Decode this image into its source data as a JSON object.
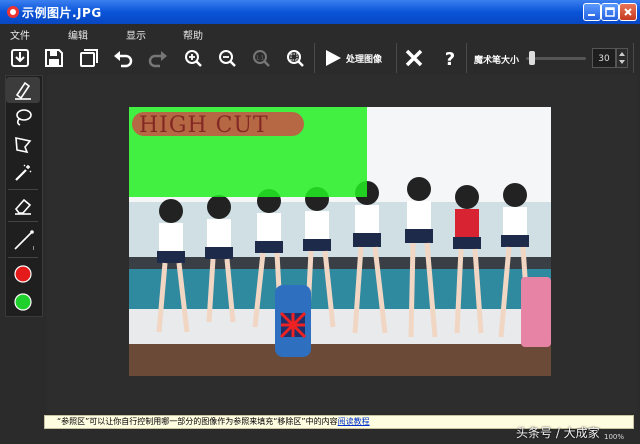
{
  "window": {
    "title": "示例图片.JPG"
  },
  "menu": [
    "文件",
    "编辑",
    "显示",
    "帮助"
  ],
  "toolbar": {
    "process_label": "处理图像",
    "brush_size_label": "魔术笔大小",
    "brush_size_value": "30",
    "brush_size_fraction": 0.05
  },
  "sidebar": {
    "tools": [
      "marker-icon",
      "lasso-icon",
      "polygon-lasso-icon",
      "magic-wand-icon",
      "eraser-icon",
      "line-icon"
    ],
    "colors": {
      "red": "#e51b1b",
      "green": "#1fcf2b"
    }
  },
  "image": {
    "logo_text": "HIGH CUT",
    "green_highlight": "#22ee22",
    "red_logo": "#d34545"
  },
  "status": {
    "tip_text": "“参照区”可以让你自行控制用哪一部分的图像作为参照来填充“移除区”中的内容",
    "tip_link": "阅读教程",
    "watermark": "头条号 / 大成家",
    "zoom": "100%"
  }
}
